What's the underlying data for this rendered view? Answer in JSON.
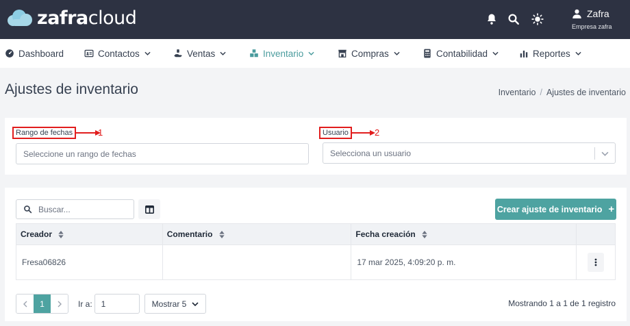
{
  "header": {
    "logo": {
      "part1": "zafra",
      "part2": "cloud"
    },
    "icons": [
      "bell-icon",
      "search-icon",
      "sun-icon",
      "user-icon"
    ],
    "user": {
      "name": "Zafra",
      "company": "Empresa zafra"
    }
  },
  "nav": {
    "items": [
      {
        "label": "Dashboard",
        "icon": "dashboard-icon",
        "dropdown": false,
        "active": false
      },
      {
        "label": "Contactos",
        "icon": "contacts-icon",
        "dropdown": true,
        "active": false
      },
      {
        "label": "Ventas",
        "icon": "sales-icon",
        "dropdown": true,
        "active": false
      },
      {
        "label": "Inventario",
        "icon": "inventory-icon",
        "dropdown": true,
        "active": true
      },
      {
        "label": "Compras",
        "icon": "store-icon",
        "dropdown": true,
        "active": false
      },
      {
        "label": "Contabilidad",
        "icon": "calculator-icon",
        "dropdown": true,
        "active": false
      },
      {
        "label": "Reportes",
        "icon": "bar-chart-icon",
        "dropdown": true,
        "active": false
      }
    ],
    "active_color": "#4b9c9e"
  },
  "page": {
    "title": "Ajustes de inventario",
    "breadcrumb": [
      "Inventario",
      "Ajustes de inventario"
    ]
  },
  "filters": {
    "date_range": {
      "label": "Rango de fechas",
      "placeholder": "Seleccione un rango de fechas",
      "annotation": "1"
    },
    "user": {
      "label": "Usuario",
      "placeholder": "Selecciona un usuario",
      "annotation": "2"
    }
  },
  "toolbar": {
    "search_placeholder": "Buscar...",
    "create_label": "Crear ajuste de inventario",
    "create_icon": "plus-icon"
  },
  "table": {
    "columns": [
      "Creador",
      "Comentario",
      "Fecha creación",
      ""
    ],
    "rows": [
      {
        "creator": "Fresa06826",
        "comment": "",
        "date": "17 mar 2025, 4:09:20 p. m."
      }
    ]
  },
  "pagination": {
    "current_page": "1",
    "goto_label": "Ir a:",
    "goto_value": "1",
    "show_label": "Mostrar 5",
    "results_text": "Mostrando 1 a 1 de 1 registro"
  },
  "colors": {
    "header_bg": "#2d3242",
    "accent": "#4ea3a1",
    "annotation": "#e11d1d"
  }
}
